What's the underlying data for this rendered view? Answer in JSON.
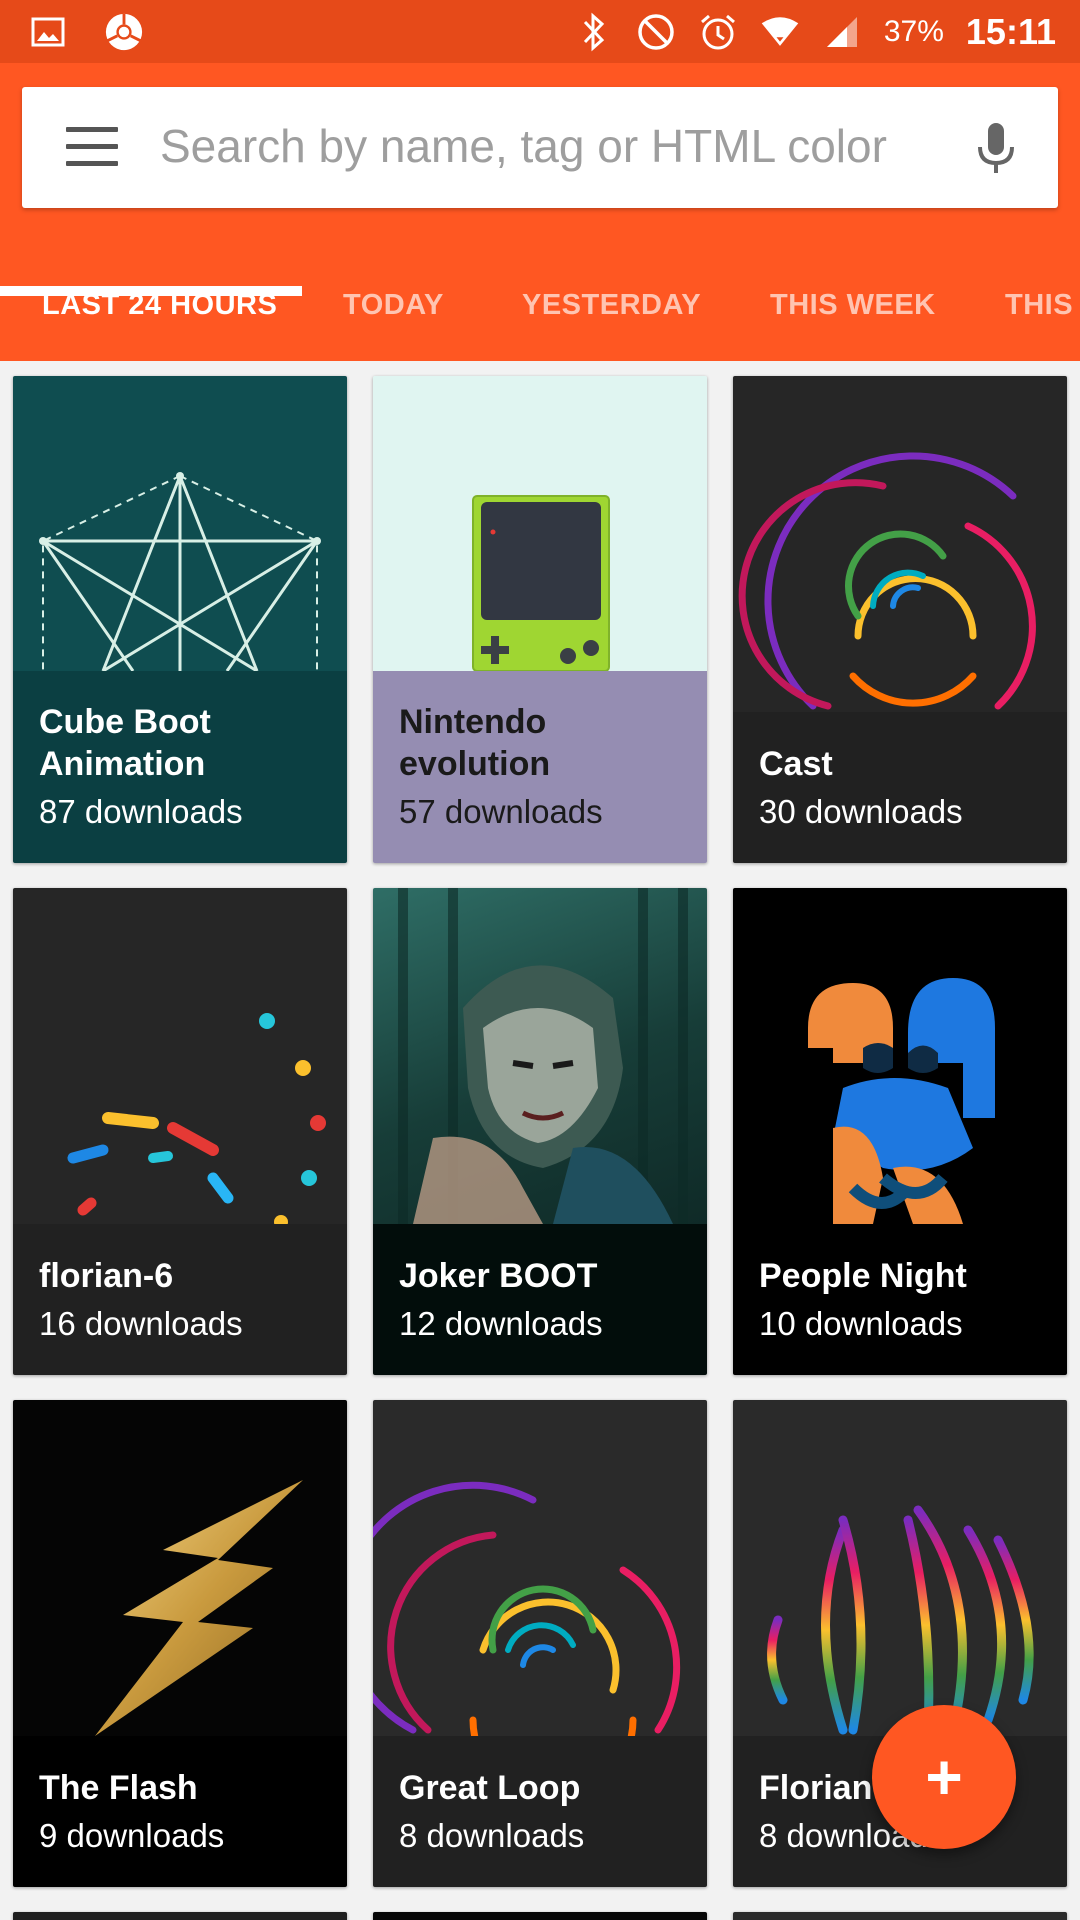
{
  "status_bar": {
    "battery": "37%",
    "time": "15:11",
    "icons": [
      "gallery-icon",
      "chrome-icon",
      "bluetooth-icon",
      "do-not-disturb-icon",
      "alarm-icon",
      "wifi-icon",
      "signal-icon",
      "battery-icon"
    ]
  },
  "search": {
    "placeholder": "Search by name, tag or HTML color",
    "menu_icon": "menu-icon",
    "mic_icon": "mic-icon"
  },
  "tabs": [
    {
      "label": "LAST 24 HOURS",
      "active": true
    },
    {
      "label": "TODAY",
      "active": false
    },
    {
      "label": "YESTERDAY",
      "active": false
    },
    {
      "label": "THIS WEEK",
      "active": false
    },
    {
      "label": "THIS",
      "active": false
    }
  ],
  "cards": [
    {
      "title": "Cube Boot Animation",
      "title_lines": [
        "Cube Boot",
        "Animation"
      ],
      "downloads": "87 downloads",
      "image_bg": "#0f4d50",
      "info_bg": "#0b3f42",
      "text_color": "#ffffff"
    },
    {
      "title": "Nintendo evolution",
      "title_lines": [
        "Nintendo",
        "evolution"
      ],
      "downloads": "57 downloads",
      "image_bg": "#e0f5f1",
      "info_bg": "#958db2",
      "text_color": "#1a1a1a"
    },
    {
      "title": "Cast",
      "title_lines": [
        "Cast"
      ],
      "downloads": "30 downloads",
      "image_bg": "#262626",
      "info_bg": "#212121",
      "text_color": "#ffffff"
    },
    {
      "title": "florian-6",
      "title_lines": [
        "florian-6"
      ],
      "downloads": "16 downloads",
      "image_bg": "#262626",
      "info_bg": "#212121",
      "text_color": "#ffffff"
    },
    {
      "title": "Joker BOOT",
      "title_lines": [
        "Joker BOOT"
      ],
      "downloads": "12 downloads",
      "image_bg": "#1e4a45",
      "info_bg": "#020d0b",
      "text_color": "#ffffff"
    },
    {
      "title": "People Night",
      "title_lines": [
        "People Night"
      ],
      "downloads": "10 downloads",
      "image_bg": "#000000",
      "info_bg": "#000000",
      "text_color": "#ffffff"
    },
    {
      "title": "The Flash",
      "title_lines": [
        "The Flash"
      ],
      "downloads": "9 downloads",
      "image_bg": "#050505",
      "info_bg": "#000000",
      "text_color": "#ffffff"
    },
    {
      "title": "Great Loop",
      "title_lines": [
        "Great Loop"
      ],
      "downloads": "8 downloads",
      "image_bg": "#2a2a2a",
      "info_bg": "#212121",
      "text_color": "#ffffff"
    },
    {
      "title": "Florian",
      "title_lines": [
        "Florian"
      ],
      "downloads": "8 downloads",
      "image_bg": "#2a2a2a",
      "info_bg": "#212121",
      "text_color": "#ffffff"
    }
  ],
  "colors": {
    "status_bar": "#e64a19",
    "app_bar": "#ff5722",
    "accent": "#ff5722"
  },
  "fab": {
    "label": "+",
    "icon": "add-icon"
  }
}
